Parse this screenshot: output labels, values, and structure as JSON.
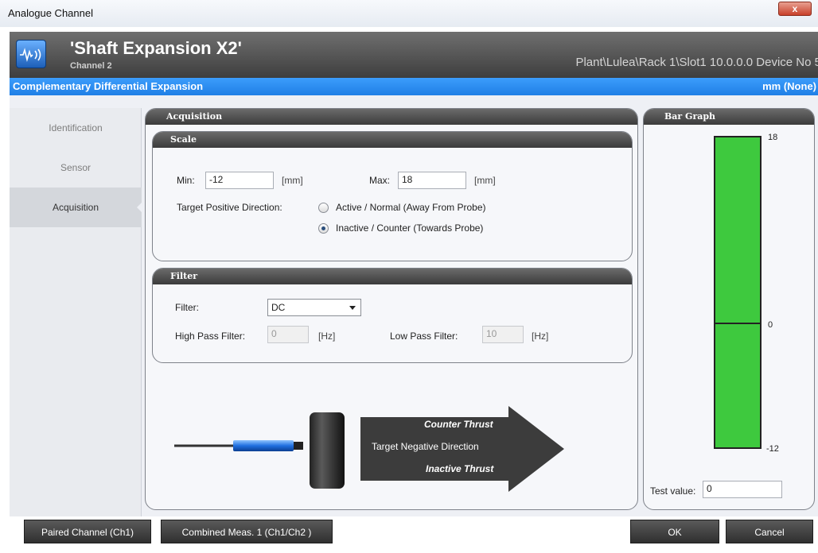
{
  "window": {
    "title": "Analogue Channel",
    "close_label": "x"
  },
  "header": {
    "title": "'Shaft Expansion X2'",
    "subtitle": "Channel 2",
    "path": "Plant\\Lulea\\Rack 1\\Slot1 10.0.0.0 Device No 5"
  },
  "bluebar": {
    "left": "Complementary Differential Expansion",
    "right": "mm (None)"
  },
  "sidebar": {
    "items": [
      {
        "label": "Identification"
      },
      {
        "label": "Sensor"
      },
      {
        "label": "Acquisition"
      }
    ]
  },
  "acquisition": {
    "title": "Acquisition",
    "scale": {
      "title": "Scale",
      "min_label": "Min:",
      "min_value": "-12",
      "min_unit": "[mm]",
      "max_label": "Max:",
      "max_value": "18",
      "max_unit": "[mm]",
      "direction_label": "Target Positive Direction:",
      "options": [
        {
          "label": "Active / Normal (Away From Probe)",
          "selected": false
        },
        {
          "label": "Inactive / Counter (Towards Probe)",
          "selected": true
        }
      ]
    },
    "filter": {
      "title": "Filter",
      "filter_label": "Filter:",
      "filter_value": "DC",
      "hp_label": "High Pass Filter:",
      "hp_value": "0",
      "hp_unit": "[Hz]",
      "lp_label": "Low Pass Filter:",
      "lp_value": "10",
      "lp_unit": "[Hz]"
    },
    "diagram": {
      "line1": "Counter Thrust",
      "line2": "Target Negative Direction",
      "line3": "Inactive Thrust"
    }
  },
  "bargraph": {
    "title": "Bar Graph",
    "max_tick": "18",
    "zero_tick": "0",
    "min_tick": "-12",
    "test_label": "Test value:",
    "test_value": "0",
    "range": [
      -12,
      18
    ],
    "value": 0,
    "bar_color": "#3ec93e"
  },
  "footer": {
    "paired": "Paired Channel (Ch1)",
    "combined": "Combined Meas. 1 (Ch1/Ch2 )",
    "ok": "OK",
    "cancel": "Cancel"
  }
}
